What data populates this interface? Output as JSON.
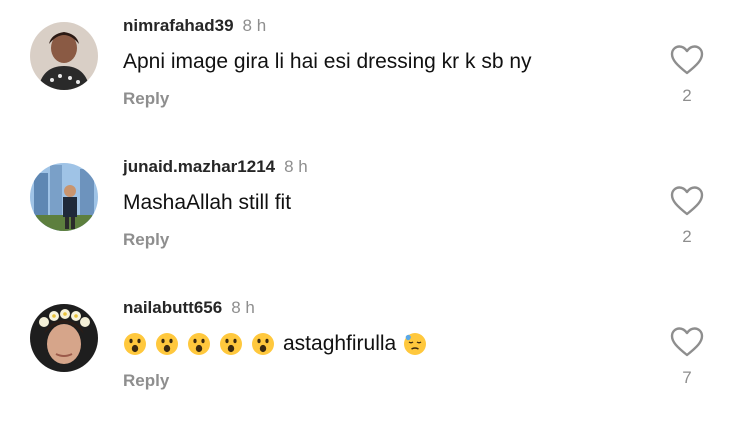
{
  "comments": [
    {
      "username": "nimrafahad39",
      "time": "8 h",
      "text": "Apni image gira li hai esi dressing kr k sb ny",
      "reply_label": "Reply",
      "likes": "2",
      "avatar_icon": "user-photo-avatar"
    },
    {
      "username": "junaid.mazhar1214",
      "time": "8 h",
      "text": "MashaAllah still fit",
      "reply_label": "Reply",
      "likes": "2",
      "avatar_icon": "user-photo-avatar"
    },
    {
      "username": "nailabutt656",
      "time": "8 h",
      "text": "astaghfirulla",
      "emojis_before": [
        "hushed-face",
        "hushed-face",
        "hushed-face",
        "hushed-face",
        "hushed-face"
      ],
      "emoji_after": "downcast-face-with-sweat",
      "reply_label": "Reply",
      "likes": "7",
      "avatar_icon": "user-photo-avatar"
    }
  ],
  "icons": {
    "like": "heart-outline-icon"
  },
  "colors": {
    "username": "#262626",
    "muted": "#8e8e8e",
    "text": "#111111",
    "emoji_yellow": "#ffc83d"
  }
}
